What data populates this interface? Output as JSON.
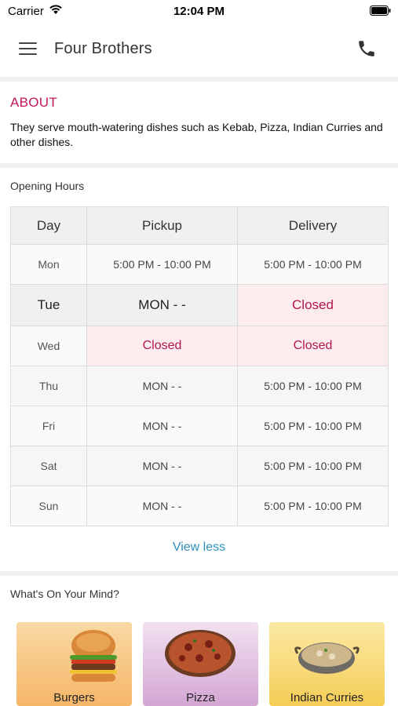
{
  "status_bar": {
    "carrier": "Carrier",
    "time": "12:04 PM"
  },
  "nav": {
    "title": "Four Brothers"
  },
  "about": {
    "title": "ABOUT",
    "text": "They serve mouth-watering dishes such as Kebab, Pizza, Indian Curries and other dishes."
  },
  "hours": {
    "title": "Opening Hours",
    "headers": [
      "Day",
      "Pickup",
      "Delivery"
    ],
    "rows": [
      {
        "day": "Mon",
        "pickup": "5:00 PM - 10:00 PM",
        "delivery": "5:00 PM - 10:00 PM"
      },
      {
        "day": "Tue",
        "pickup": "MON  - -",
        "delivery": "Closed"
      },
      {
        "day": "Wed",
        "pickup": "Closed",
        "delivery": "Closed"
      },
      {
        "day": "Thu",
        "pickup": "MON  - -",
        "delivery": "5:00 PM - 10:00 PM"
      },
      {
        "day": "Fri",
        "pickup": "MON  - -",
        "delivery": "5:00 PM - 10:00 PM"
      },
      {
        "day": "Sat",
        "pickup": "MON  - -",
        "delivery": "5:00 PM - 10:00 PM"
      },
      {
        "day": "Sun",
        "pickup": "MON  - -",
        "delivery": "5:00 PM - 10:00 PM"
      }
    ],
    "view_less": "View less"
  },
  "mind": {
    "title": "What's On Your Mind?",
    "categories": [
      {
        "label": "Burgers",
        "color": "#f7c98a"
      },
      {
        "label": "Pizza",
        "color": "#dcb6dc"
      },
      {
        "label": "Indian Curries",
        "color": "#f8da79"
      }
    ]
  },
  "colors": {
    "accent": "#c2185b",
    "link": "#2e8fbf",
    "closed_bg": "#fdecee"
  }
}
